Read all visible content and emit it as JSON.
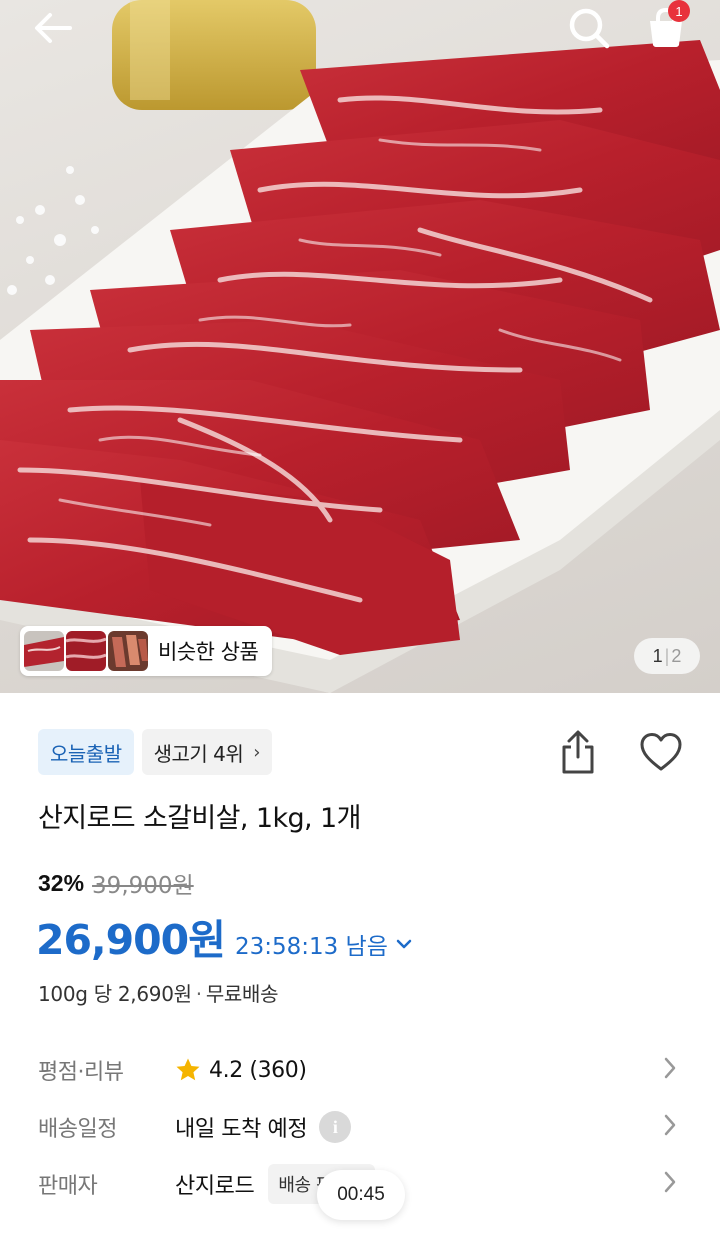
{
  "topbar": {
    "back_icon": "arrow-left-icon",
    "search_icon": "search-icon",
    "cart_icon": "shopping-bag-icon",
    "cart_count": "1"
  },
  "gallery": {
    "similar_label": "비슷한 상품",
    "current_page": "1",
    "total_pages": "2"
  },
  "badges": {
    "delivery": "오늘출발",
    "ranking": "생고기 4위",
    "ranking_arrow": "›"
  },
  "product": {
    "title": "산지로드 소갈비살, 1kg, 1개",
    "discount_rate": "32%",
    "original_price": "39,900원",
    "sale_price": "26,900원",
    "countdown": "23:58:13 남음",
    "unit_price": "100g 당 2,690원",
    "dot": "·",
    "shipping": "무료배송"
  },
  "info": {
    "rating_label": "평점·리뷰",
    "rating_value": "4.2 (360)",
    "delivery_label": "배송일정",
    "delivery_value": "내일 도착 예정",
    "seller_label": "판매자",
    "seller_value": "산지로드",
    "seller_badge": "배송 판매자"
  },
  "overlay": {
    "timer": "00:45"
  },
  "colors": {
    "accent_blue": "#1d6bc9",
    "badge_blue_bg": "#e6f1fb",
    "cart_badge": "#e8323c",
    "star": "#f5b400"
  }
}
